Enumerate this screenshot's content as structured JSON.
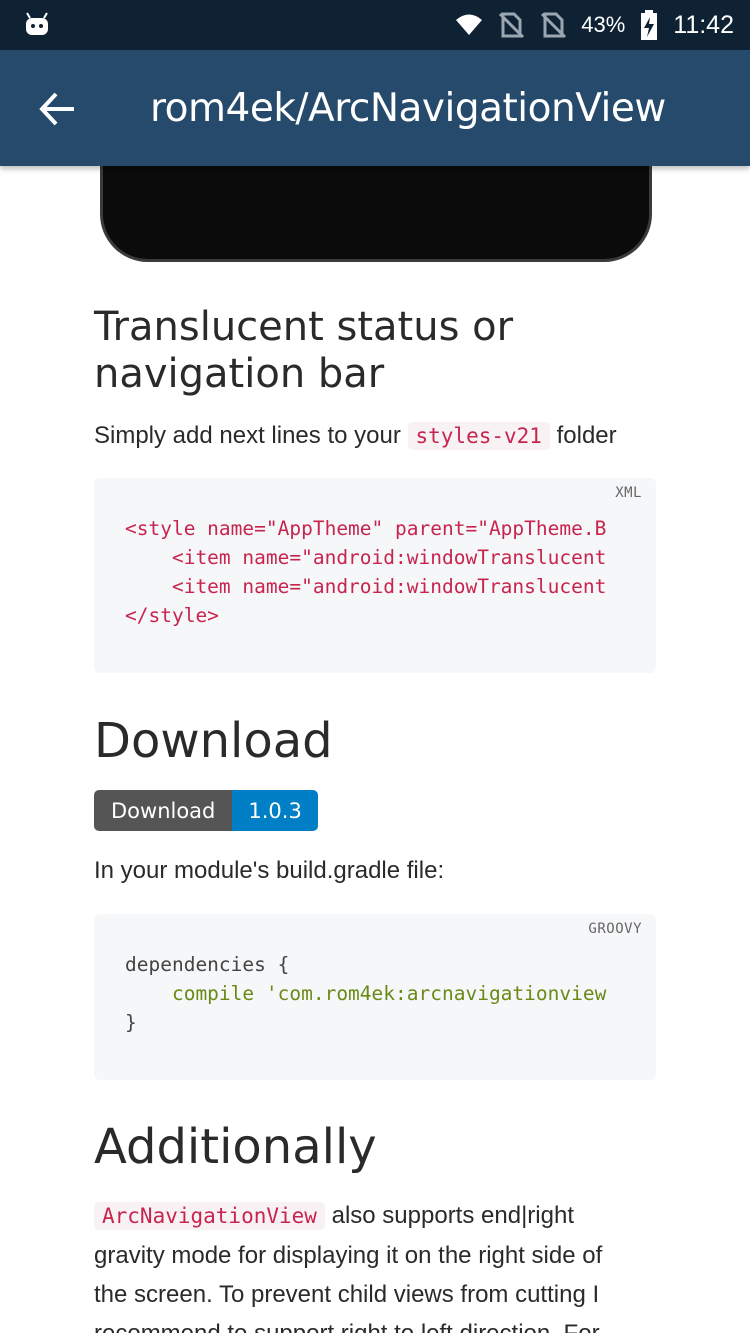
{
  "status_bar": {
    "battery_percent": "43%",
    "time": "11:42",
    "icons": [
      "android-robot-icon",
      "wifi-icon",
      "no-sim-icon",
      "no-sim-icon",
      "battery-charging-icon"
    ]
  },
  "app_bar": {
    "back_icon": "arrow-back-icon",
    "title": "rom4ek/ArcNavigationView"
  },
  "sections": {
    "translucent": {
      "heading": "Translucent status or navigation bar",
      "text_before": "Simply add next lines to your ",
      "inline_code": "styles-v21",
      "text_after": " folder",
      "code_lang": "XML",
      "code_lines": [
        "<style name=\"AppTheme\" parent=\"AppTheme.B",
        "    <item name=\"android:windowTranslucent",
        "    <item name=\"android:windowTranslucent",
        "</style>"
      ]
    },
    "download": {
      "heading": "Download",
      "badge_label": "Download",
      "badge_version": "1.0.3",
      "text": "In your module's build.gradle file:",
      "code_lang": "GROOVY",
      "code_lines": [
        "dependencies {",
        "    compile 'com.rom4ek:arcnavigationview",
        "}"
      ]
    },
    "additionally": {
      "heading": "Additionally",
      "inline_code": "ArcNavigationView",
      "text": " also supports end|right gravity mode for displaying it on the right side of the screen. To prevent child views from cutting I recommend to support right to left direction. For"
    }
  },
  "colors": {
    "status_bar": "#0e2233",
    "app_bar": "#264a6b",
    "inline_code": "#c7254e",
    "badge_left": "#555555",
    "badge_right": "#007ec6"
  }
}
